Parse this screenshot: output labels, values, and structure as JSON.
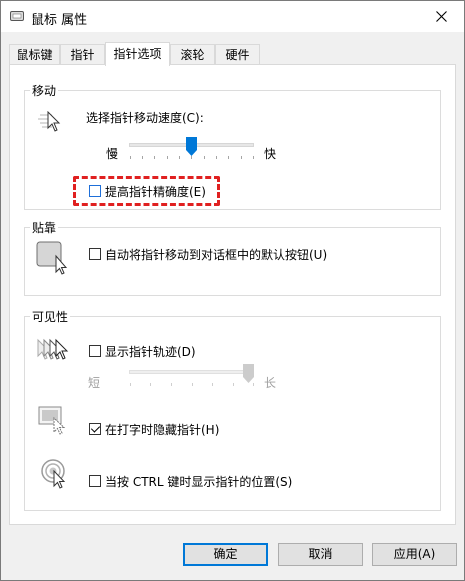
{
  "window": {
    "title": "鼠标 属性",
    "title_icon": "mouse-icon",
    "close_icon": "close-icon"
  },
  "tabs": [
    {
      "label": "鼠标键",
      "active": false
    },
    {
      "label": "指针",
      "active": false
    },
    {
      "label": "指针选项",
      "active": true
    },
    {
      "label": "滚轮",
      "active": false
    },
    {
      "label": "硬件",
      "active": false
    }
  ],
  "motion": {
    "group_title": "移动",
    "speed_label": "选择指针移动速度(C):",
    "slow_label": "慢",
    "fast_label": "快",
    "speed_value_fraction": 0.5,
    "precision_label": "提高指针精确度(E)",
    "precision_checked": false,
    "icon": "pointer-speed-icon"
  },
  "snap": {
    "group_title": "贴靠",
    "snap_label": "自动将指针移动到对话框中的默认按钮(U)",
    "snap_checked": false,
    "icon": "snap-to-button-icon"
  },
  "visibility": {
    "group_title": "可见性",
    "trails_label": "显示指针轨迹(D)",
    "trails_checked": false,
    "short_label": "短",
    "long_label": "长",
    "trail_value_fraction": 1.0,
    "hide_typing_label": "在打字时隐藏指针(H)",
    "hide_typing_checked": true,
    "ctrl_label": "当按 CTRL 键时显示指针的位置(S)",
    "ctrl_checked": false,
    "icons": [
      "pointer-trails-icon",
      "hide-pointer-icon",
      "pointer-location-icon"
    ]
  },
  "buttons": {
    "ok": "确定",
    "cancel": "取消",
    "apply": "应用(A)"
  },
  "colors": {
    "highlight": "#e02020",
    "accent": "#0078d7",
    "slider_thumb": "#0078d7"
  }
}
